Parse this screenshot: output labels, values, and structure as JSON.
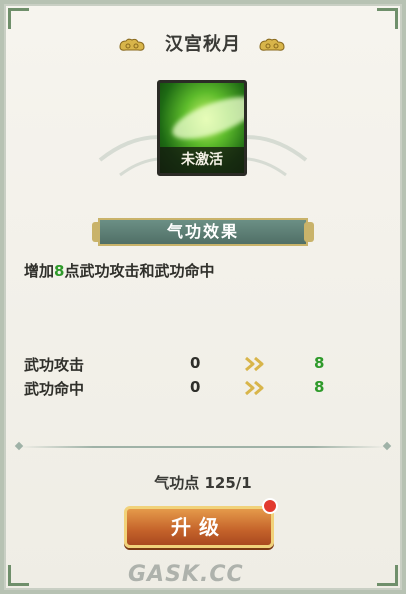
{
  "header": {
    "title": "汉宫秋月"
  },
  "skill": {
    "status": "未激活"
  },
  "effect": {
    "banner": "气功效果",
    "desc_prefix": "增加",
    "desc_num": "8",
    "desc_suffix": "点武功攻击和武功命中"
  },
  "stats": [
    {
      "name": "武功攻击",
      "current": "0",
      "next": "8"
    },
    {
      "name": "武功命中",
      "current": "0",
      "next": "8"
    }
  ],
  "points": {
    "text": "气功点 125/1"
  },
  "upgrade": {
    "label": "升级"
  },
  "watermark": {
    "text": "GASK.CC"
  },
  "colors": {
    "accent_green": "#2e9a2a",
    "button_orange": "#c4622a",
    "badge_red": "#e23a2f"
  },
  "icons": [
    "cloud-ornament-icon",
    "double-chevron-right-icon",
    "notification-dot-icon"
  ]
}
